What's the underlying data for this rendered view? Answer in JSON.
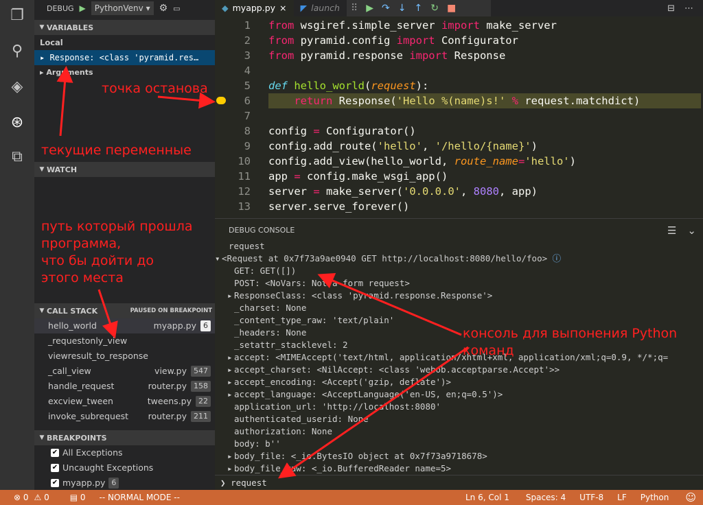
{
  "debug_bar": {
    "label": "DEBUG",
    "config": "PythonVenv"
  },
  "tabs": [
    {
      "label": "myapp.py"
    },
    {
      "label": "launch"
    }
  ],
  "variables": {
    "header": "VARIABLES",
    "local": "Local",
    "response_item": "Response: <class 'pyramid.res…",
    "arguments": "Arguments"
  },
  "watch": {
    "header": "WATCH"
  },
  "call_stack": {
    "header": "CALL STACK",
    "status": "PAUSED ON BREAKPOINT",
    "frames": [
      {
        "name": "hello_world",
        "file": "myapp.py",
        "line": "6"
      },
      {
        "name": "_requestonly_view",
        "file": "",
        "line": ""
      },
      {
        "name": "viewresult_to_response",
        "file": "",
        "line": ""
      },
      {
        "name": "_call_view",
        "file": "view.py",
        "line": "547"
      },
      {
        "name": "handle_request",
        "file": "router.py",
        "line": "158"
      },
      {
        "name": "excview_tween",
        "file": "tweens.py",
        "line": "22"
      },
      {
        "name": "invoke_subrequest",
        "file": "router.py",
        "line": "211"
      }
    ]
  },
  "breakpoints": {
    "header": "BREAKPOINTS",
    "items": [
      {
        "label": "All Exceptions",
        "badge": ""
      },
      {
        "label": "Uncaught Exceptions",
        "badge": ""
      },
      {
        "label": "myapp.py",
        "badge": "6"
      }
    ]
  },
  "editor": {
    "lines": [
      "1",
      "2",
      "3",
      "4",
      "5",
      "6",
      "7",
      "8",
      "9",
      "10",
      "11",
      "12",
      "13"
    ]
  },
  "debug_console": {
    "header": "DEBUG CONSOLE",
    "lines": [
      "request",
      "<Request at 0x7f73a9ae0940 GET http://localhost:8080/hello/foo>",
      "GET: GET([])",
      "POST: <NoVars: Not a form request>",
      "ResponseClass: <class 'pyramid.response.Response'>",
      "_charset: None",
      "_content_type_raw: 'text/plain'",
      "_headers: None",
      "_setattr_stacklevel: 2",
      "accept: <MIMEAccept('text/html, application/xhtml+xml, application/xml;q=0.9, */*;q=",
      "accept_charset: <NilAccept: <class 'webob.acceptparse.Accept'>>",
      "accept_encoding: <Accept('gzip, deflate')>",
      "accept_language: <AcceptLanguage('en-US, en;q=0.5')>",
      "application_url: 'http://localhost:8080'",
      "authenticated_userid: None",
      "authorization: None",
      "body: b''",
      "body_file: <_io.BytesIO object at 0x7f73a9718678>",
      "body_file_raw: <_io.BufferedReader name=5>"
    ],
    "input": "request"
  },
  "status_bar": {
    "errors": "0",
    "warnings": "0",
    "threads": "0",
    "mode": "-- NORMAL MODE --",
    "position": "Ln 6, Col 1",
    "spaces": "Spaces: 4",
    "encoding": "UTF-8",
    "eol": "LF",
    "language": "Python"
  },
  "annotations": {
    "breakpoint": "точка останова",
    "variables": "текущие переменные",
    "path": [
      "путь который прошла",
      "программа,",
      "что бы дойти до",
      "этого места"
    ],
    "console": [
      "консоль для выпонения Python",
      "команд"
    ]
  },
  "colors": {
    "status_bar": "#cc6633",
    "annotation": "#ff2020",
    "accent": "#094771"
  }
}
